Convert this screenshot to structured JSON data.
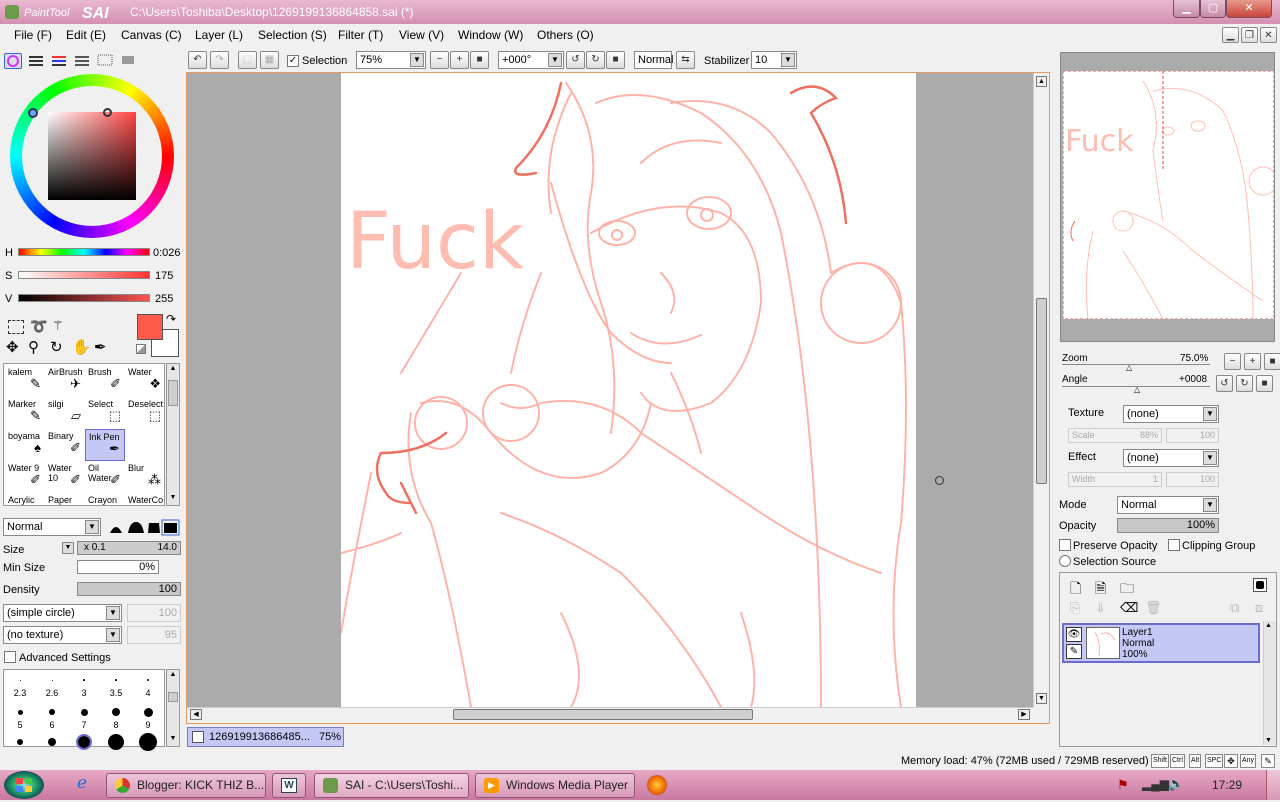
{
  "window": {
    "title": "C:\\Users\\Toshiba\\Desktop\\1269199136864858.sai (*)",
    "logo_text": "PaintTool SAI"
  },
  "menu": [
    "File (F)",
    "Edit (E)",
    "Canvas (C)",
    "Layer (L)",
    "Selection (S)",
    "Filter (T)",
    "View (V)",
    "Window (W)",
    "Others (O)"
  ],
  "toolbar": {
    "selection_label": "Selection",
    "zoom": "75%",
    "angle": "+000°",
    "blend_mode": "Normal",
    "stabilizer_label": "Stabilizer",
    "stabilizer_value": "10"
  },
  "color": {
    "h_label": "H",
    "h_value": "0:026",
    "s_label": "S",
    "s_value": "175",
    "v_label": "V",
    "v_value": "255",
    "primary": "#ff5a4a",
    "secondary": "#ffffff"
  },
  "brushes": [
    {
      "label": "kalem"
    },
    {
      "label": "AirBrush"
    },
    {
      "label": "Brush"
    },
    {
      "label": "Water"
    },
    {
      "label": "Marker"
    },
    {
      "label": "silgi"
    },
    {
      "label": "Select"
    },
    {
      "label": "Deselect"
    },
    {
      "label": "boyama"
    },
    {
      "label": "Binary"
    },
    {
      "label": "Ink Pen"
    },
    {
      "label": ""
    },
    {
      "label": "Water 9"
    },
    {
      "label": "Water 10"
    },
    {
      "label": "Oil Water"
    },
    {
      "label": "Blur"
    },
    {
      "label": "Acrylic"
    },
    {
      "label": "Paper"
    },
    {
      "label": "Crayon"
    },
    {
      "label": "WaterCo"
    }
  ],
  "brush_settings": {
    "mode": "Normal",
    "size_label": "Size",
    "size_mult": "x 0.1",
    "size_value": "14.0",
    "minsize_label": "Min Size",
    "minsize_value": "0%",
    "density_label": "Density",
    "density_value": "100",
    "shape": "(simple circle)",
    "shape_value": "100",
    "texture": "(no texture)",
    "texture_value": "95",
    "advanced_label": "Advanced Settings"
  },
  "size_presets": [
    "2.3",
    "2.6",
    "3",
    "3.5",
    "4",
    "5",
    "6",
    "7",
    "8",
    "9"
  ],
  "navigator": {
    "zoom_label": "Zoom",
    "zoom_value": "75.0%",
    "angle_label": "Angle",
    "angle_value": "+0008"
  },
  "layer_props": {
    "texture_label": "Texture",
    "texture_value": "(none)",
    "scale_label": "Scale",
    "scale_value": "88%",
    "scale_num": "100",
    "effect_label": "Effect",
    "effect_value": "(none)",
    "width_label": "Width",
    "width_value": "1",
    "width_num": "100",
    "mode_label": "Mode",
    "mode_value": "Normal",
    "opacity_label": "Opacity",
    "opacity_value": "100%",
    "preserve_label": "Preserve Opacity",
    "clipping_label": "Clipping Group",
    "selsource_label": "Selection Source"
  },
  "layers": [
    {
      "name": "Layer1",
      "mode": "Normal",
      "opacity": "100%"
    }
  ],
  "doc_tab": {
    "name": "126919913686485...",
    "zoom": "75%"
  },
  "canvas_text": "Fuck",
  "status": {
    "memory": "Memory load: 47% (72MB used / 729MB reserved)",
    "keys": [
      "Shift",
      "Ctrl",
      "Alt",
      "SPC",
      "Any"
    ]
  },
  "taskbar": {
    "items": [
      "Blogger: KICK THIZ B...",
      "",
      "SAI - C:\\Users\\Toshi...",
      "Windows Media Player"
    ],
    "clock": "17:29"
  }
}
